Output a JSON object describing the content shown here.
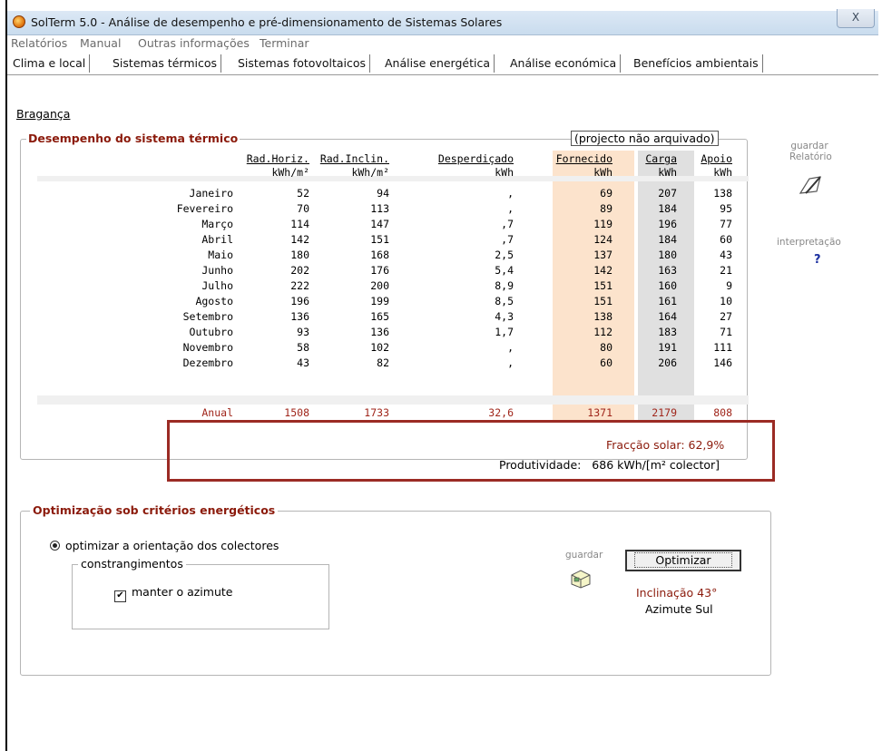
{
  "window": {
    "title": "SolTerm 5.0 - Análise de desempenho e pré-dimensionamento de Sistemas Solares",
    "close_label": "X"
  },
  "menu": [
    "Relatórios",
    "Manual",
    "Outras informações",
    "Terminar"
  ],
  "tabs": [
    {
      "label": "Clima e local",
      "active": false
    },
    {
      "label": "Sistemas térmicos",
      "active": false
    },
    {
      "label": "Sistemas fotovoltaicos",
      "active": false
    },
    {
      "label": "Análise energética",
      "active": true
    },
    {
      "label": "Análise económica",
      "active": false
    },
    {
      "label": "Benefícios ambientais",
      "active": false
    }
  ],
  "location": "Bragança",
  "thermal": {
    "title": "Desempenho do sistema térmico",
    "archived": "(projecto não arquivado)",
    "columns": [
      "Rad.Horiz.",
      "Rad.Inclin.",
      "Desperdiçado",
      "Fornecido",
      "Carga",
      "Apoio"
    ],
    "units": [
      "kWh/m²",
      "kWh/m²",
      "kWh",
      "kWh",
      "kWh",
      "kWh"
    ],
    "rows": [
      {
        "month": "Janeiro",
        "values": [
          "52",
          "94",
          ",",
          "69",
          "207",
          "138"
        ]
      },
      {
        "month": "Fevereiro",
        "values": [
          "70",
          "113",
          ",",
          "89",
          "184",
          "95"
        ]
      },
      {
        "month": "Março",
        "values": [
          "114",
          "147",
          ",7",
          "119",
          "196",
          "77"
        ]
      },
      {
        "month": "Abril",
        "values": [
          "142",
          "151",
          ",7",
          "124",
          "184",
          "60"
        ]
      },
      {
        "month": "Maio",
        "values": [
          "180",
          "168",
          "2,5",
          "137",
          "180",
          "43"
        ]
      },
      {
        "month": "Junho",
        "values": [
          "202",
          "176",
          "5,4",
          "142",
          "163",
          "21"
        ]
      },
      {
        "month": "Julho",
        "values": [
          "222",
          "200",
          "8,9",
          "151",
          "160",
          "9"
        ]
      },
      {
        "month": "Agosto",
        "values": [
          "196",
          "199",
          "8,5",
          "151",
          "161",
          "10"
        ]
      },
      {
        "month": "Setembro",
        "values": [
          "136",
          "165",
          "4,3",
          "138",
          "164",
          "27"
        ]
      },
      {
        "month": "Outubro",
        "values": [
          "93",
          "136",
          "1,7",
          "112",
          "183",
          "71"
        ]
      },
      {
        "month": "Novembro",
        "values": [
          "58",
          "102",
          ",",
          "80",
          "191",
          "111"
        ]
      },
      {
        "month": "Dezembro",
        "values": [
          "43",
          "82",
          ",",
          "60",
          "206",
          "146"
        ]
      }
    ],
    "annual": {
      "month": "Anual",
      "values": [
        "1508",
        "1733",
        "32,6",
        "1371",
        "2179",
        "808"
      ]
    },
    "fraccao_label": "Fracção solar:",
    "fraccao_value": "62,9%",
    "produt_label": "Produtividade:",
    "produt_value": "686 kWh/[m² colector]"
  },
  "side": {
    "guardar_label": "guardar",
    "relatorio_label": "Relatório",
    "interpretacao_label": "interpretação",
    "help_label": "?"
  },
  "optim": {
    "title": "Optimização sob critérios energéticos",
    "radio_label": "optimizar a orientação dos colectores",
    "constraints_title": "constrangimentos",
    "checkbox_label": "manter o azimute",
    "checkbox_mark": "✔",
    "guardar_label": "guardar",
    "button_label": "Optimizar",
    "inclinacao": "Inclinação 43°",
    "azimute": "Azimute Sul"
  }
}
